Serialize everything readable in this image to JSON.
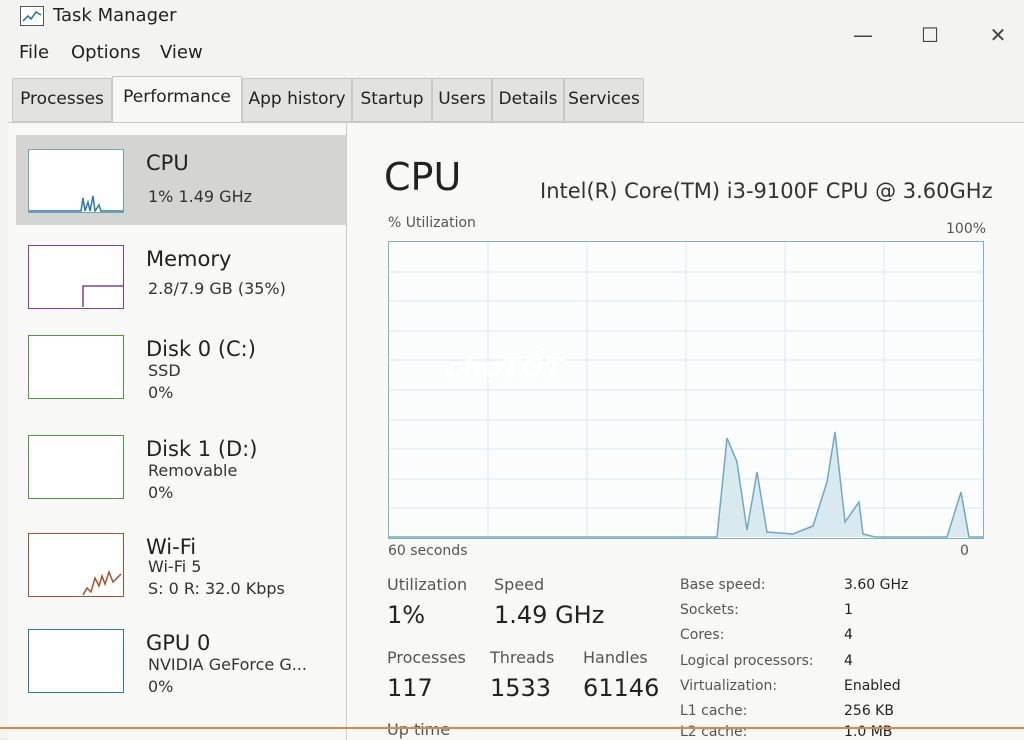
{
  "window": {
    "title": "Task Manager",
    "minimize": "—",
    "maximize": "☐",
    "close": "✕"
  },
  "menu": [
    "File",
    "Options",
    "View"
  ],
  "tabs": [
    {
      "label": "Processes"
    },
    {
      "label": "Performance",
      "active": true
    },
    {
      "label": "App history"
    },
    {
      "label": "Startup"
    },
    {
      "label": "Users"
    },
    {
      "label": "Details"
    },
    {
      "label": "Services"
    }
  ],
  "sidebar": {
    "items": [
      {
        "name": "CPU",
        "sub1": "1% 1.49 GHz",
        "sub2": "",
        "color": "#2a7aa8"
      },
      {
        "name": "Memory",
        "sub1": "2.8/7.9 GB (35%)",
        "sub2": "",
        "color": "#8a3aa8"
      },
      {
        "name": "Disk 0 (C:)",
        "sub1": "SSD",
        "sub2": "0%",
        "color": "#4c9a3a"
      },
      {
        "name": "Disk 1 (D:)",
        "sub1": "Removable",
        "sub2": "0%",
        "color": "#4c9a3a"
      },
      {
        "name": "Wi-Fi",
        "sub1": "Wi-Fi 5",
        "sub2": "S: 0 R: 32.0 Kbps",
        "color": "#a8502a"
      },
      {
        "name": "GPU 0",
        "sub1": "NVIDIA GeForce G...",
        "sub2": "0%",
        "color": "#2a7aa8"
      }
    ]
  },
  "main": {
    "title": "CPU",
    "model": "Intel(R) Core(TM) i3-9100F CPU @ 3.60GHz",
    "graph": {
      "ylabel": "% Utilization",
      "ymax_label": "100%",
      "xlabel_left": "60 seconds",
      "xlabel_right": "0"
    },
    "stats": {
      "utilization_label": "Utilization",
      "utilization_value": "1%",
      "speed_label": "Speed",
      "speed_value": "1.49 GHz",
      "processes_label": "Processes",
      "processes_value": "117",
      "threads_label": "Threads",
      "threads_value": "1533",
      "handles_label": "Handles",
      "handles_value": "61146",
      "uptime_label": "Up time"
    },
    "specs": [
      {
        "label": "Base speed:",
        "value": "3.60 GHz"
      },
      {
        "label": "Sockets:",
        "value": "1"
      },
      {
        "label": "Cores:",
        "value": "4"
      },
      {
        "label": "Logical processors:",
        "value": "4"
      },
      {
        "label": "Virtualization:",
        "value": "Enabled"
      },
      {
        "label": "L1 cache:",
        "value": "256 KB"
      },
      {
        "label": "L2 cache:",
        "value": "1.0 MB"
      }
    ]
  },
  "watermark": "chợTỐT"
}
